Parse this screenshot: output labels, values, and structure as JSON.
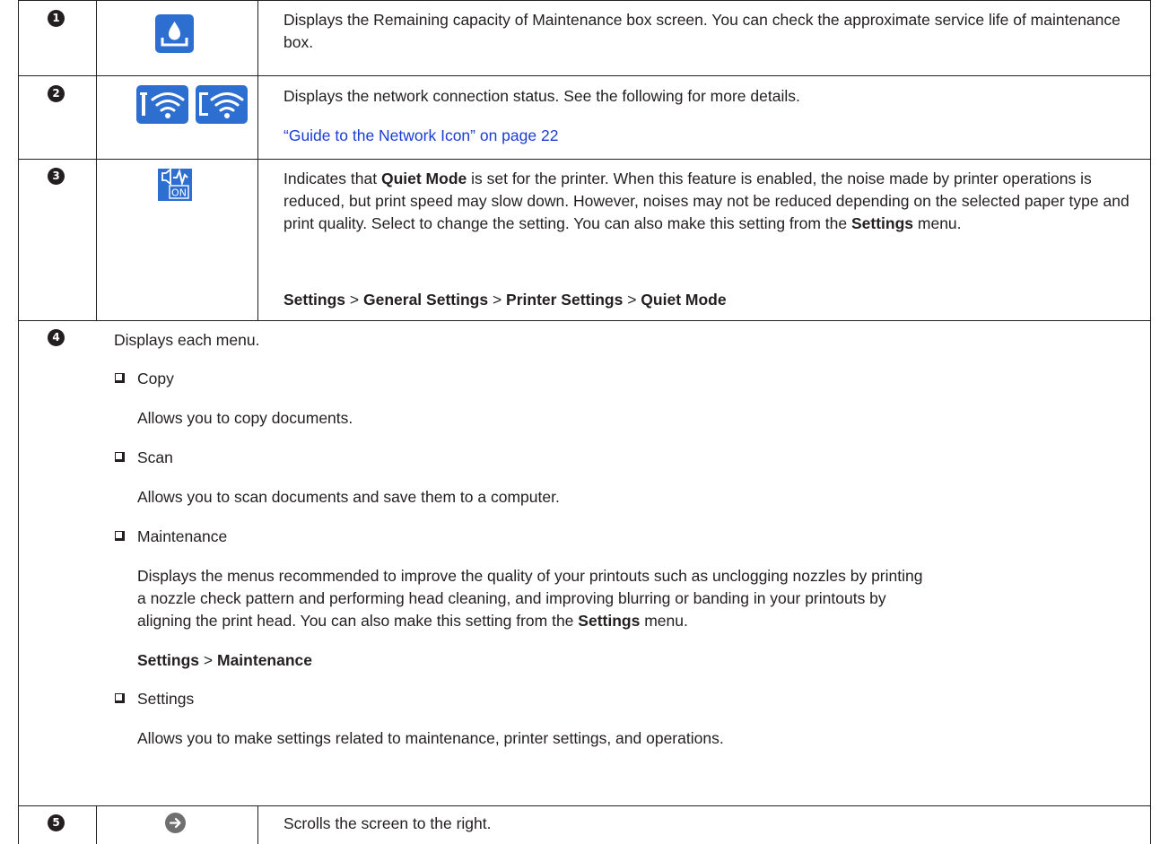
{
  "rows": [
    {
      "number": "1",
      "icon": "maintenance-box-icon",
      "description": "Displays the Remaining capacity of Maintenance box screen. You can check the approximate service life of maintenance box."
    },
    {
      "number": "2",
      "icon": "network-status-icon",
      "description": "Displays the network connection status. See the following for more details.",
      "link": "“Guide to the Network Icon” on page 22"
    },
    {
      "number": "3",
      "icon": "quiet-mode-on-icon",
      "icon_text": "ON",
      "description_parts": {
        "p1": "Indicates that ",
        "b1": "Quiet Mode",
        "p2": " is set for the printer. When this feature is enabled, the noise made by printer operations is reduced, but print speed may slow down. However, noises may not be reduced depending on the selected paper type and print quality. Select to change the setting. You can also make this setting from the ",
        "b2": "Settings",
        "p3": " menu."
      },
      "path": [
        "Settings",
        "General Settings",
        "Printer Settings",
        "Quiet Mode"
      ],
      "path_sep": " > "
    },
    {
      "number": "4",
      "intro": "Displays each menu.",
      "items": [
        {
          "label": "Copy",
          "desc": "Allows you to copy documents."
        },
        {
          "label": "Scan",
          "desc": "Allows you to scan documents and save them to a computer."
        },
        {
          "label": "Maintenance",
          "desc_lines": [
            "Displays the menus recommended to improve the quality of your printouts such as unclogging nozzles by printing",
            "a nozzle check pattern and performing head cleaning, and improving blurring or banding in your printouts by",
            "aligning the print head. You can also make this setting from the "
          ],
          "desc_bold": "Settings",
          "desc_end": " menu.",
          "path": [
            "Settings",
            "Maintenance"
          ]
        },
        {
          "label": "Settings",
          "desc": "Allows you to make settings related to maintenance, printer settings, and operations."
        }
      ]
    },
    {
      "number": "5",
      "icon": "scroll-right-arrow-icon",
      "description": "Scrolls the screen to the right."
    }
  ],
  "colors": {
    "icon_blue": "#2d6fd0",
    "link": "#1a3dd6",
    "text": "#231f20",
    "arrow_gray": "#6f6f6f"
  }
}
